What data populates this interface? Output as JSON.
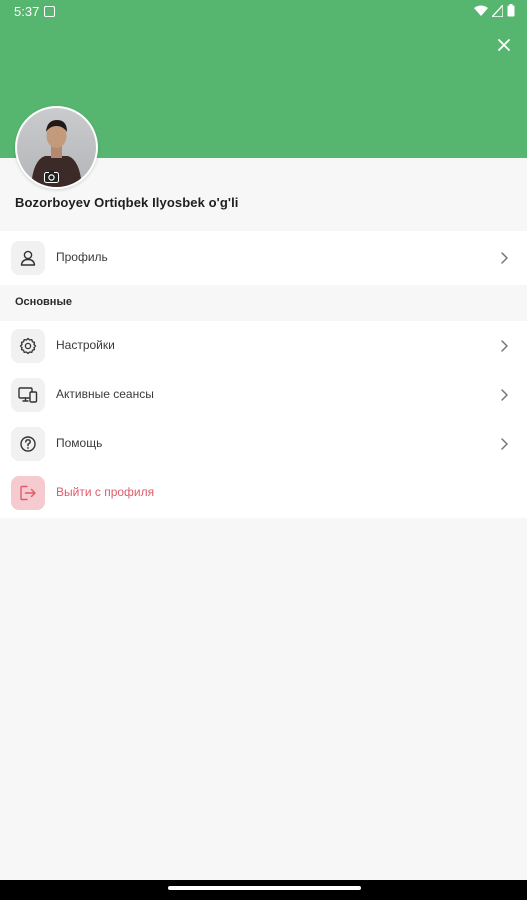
{
  "status_bar": {
    "time": "5:37"
  },
  "user": {
    "name": "Bozorboyev Ortiqbek Ilyosbek o'g'li"
  },
  "profile_item": {
    "label": "Профиль",
    "icon": "user-icon"
  },
  "section": {
    "title": "Основные"
  },
  "menu": [
    {
      "label": "Настройки",
      "icon": "gear-icon"
    },
    {
      "label": "Активные сеансы",
      "icon": "devices-icon"
    },
    {
      "label": "Помощь",
      "icon": "help-icon"
    }
  ],
  "logout": {
    "label": "Выйти с профиля",
    "icon": "logout-icon"
  },
  "colors": {
    "header": "#56b670",
    "danger": "#e05a6a",
    "danger_bg": "#f6cbd0"
  }
}
